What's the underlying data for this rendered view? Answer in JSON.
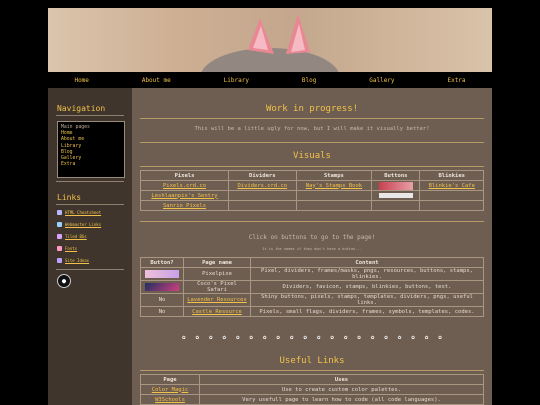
{
  "nav": [
    "Home",
    "About me",
    "Library",
    "Blog",
    "Gallery",
    "Extra"
  ],
  "sidebar": {
    "nav_title": "Navigation",
    "menu_heading": "Main pages",
    "menu_items": [
      "Home",
      "About me",
      "Library",
      "Blog",
      "Gallery",
      "Extra"
    ],
    "links_title": "Links",
    "links": [
      {
        "label": "HTML Cheatsheet",
        "color": "#b8b8ff"
      },
      {
        "label": "Webmaster Links",
        "color": "#9ad0ff"
      },
      {
        "label": "Tiled BGs",
        "color": "#d8a0ff"
      },
      {
        "label": "Fonts",
        "color": "#ff9ac8"
      },
      {
        "label": "Site Ideas",
        "color": "#c0a0ff"
      }
    ]
  },
  "main": {
    "title": "Work in progress!",
    "intro": "This will be a little ugly for now, but I will make it visually better!",
    "visuals_title": "Visuals",
    "visuals_headers": [
      "Pixels",
      "Dividers",
      "Stamps",
      "Buttons",
      "Blinkies"
    ],
    "visuals_rows": [
      [
        "Pixels.crd.co",
        "Dividers.crd.co",
        "Nay's Stamps Book",
        "",
        "Blinkie's Cafe"
      ],
      [
        "Leshlaanpix's Sentry",
        "",
        "",
        "",
        ""
      ],
      [
        "Sanrio Pixels",
        "",
        "",
        "",
        ""
      ]
    ],
    "click_note": "Click on buttons to go to the page!",
    "name_note": "It is the names if they don't have a button...",
    "resources_headers": [
      "Button?",
      "Page name",
      "Content"
    ],
    "resources_rows": [
      [
        "",
        "Pixelpixe",
        "Pixel, dividers, frames/masks, pngs, resources, buttons, stamps, blinkies."
      ],
      [
        "",
        "Coco's Pixel Safari",
        "Dividers, favicon, stamps, blinkies, buttons, text."
      ],
      [
        "No",
        "Lavender Resources",
        "Shiny buttons, pixels, stamps, templates, dividers, pngs, useful links."
      ],
      [
        "No",
        "Castle Resource",
        "Pixels, small flags, dividers, frames, symbols, templates, codes."
      ]
    ],
    "useful_title": "Useful Links",
    "useful_headers": [
      "Page",
      "Uses"
    ],
    "useful_rows": [
      [
        "Color Magic",
        "Use to create custom color palettes."
      ],
      [
        "W3Schools",
        "Very usefull page to learn how to code (all code languages)."
      ]
    ]
  },
  "colors": {
    "accent": "#f2c24a",
    "main_bg": "#6e5d51",
    "sidebar_bg": "#3f352d"
  }
}
